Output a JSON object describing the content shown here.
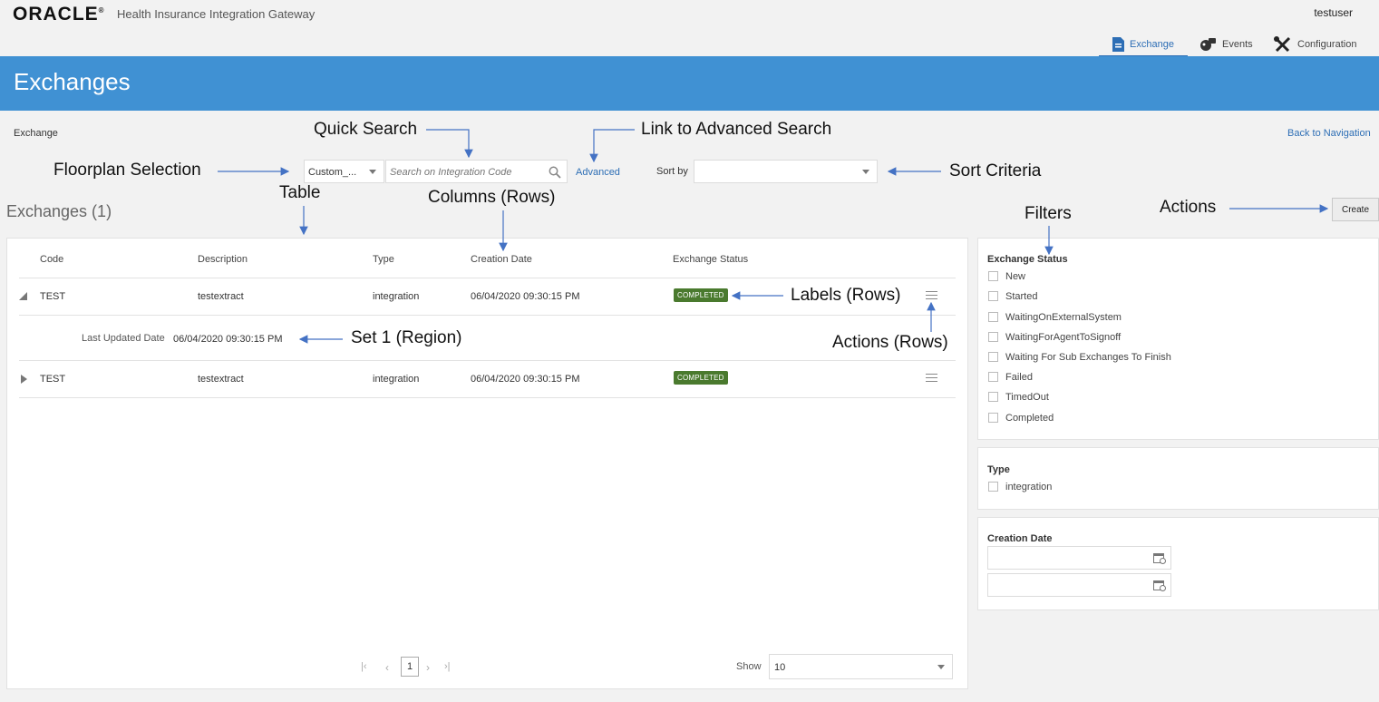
{
  "header": {
    "logo": "ORACLE",
    "app_name": "Health Insurance Integration Gateway",
    "user": "testuser",
    "tabs": [
      {
        "label": "Exchange",
        "icon": "document-icon",
        "active": true
      },
      {
        "label": "Events",
        "icon": "events-icon",
        "active": false
      },
      {
        "label": "Configuration",
        "icon": "tools-icon",
        "active": false
      }
    ]
  },
  "page": {
    "title": "Exchanges",
    "breadcrumb": "Exchange",
    "back_link": "Back to Navigation"
  },
  "toolbar": {
    "floorplan_value": "Custom_...",
    "search_placeholder": "Search on Integration Code",
    "advanced_link": "Advanced",
    "sort_label": "Sort by",
    "sort_value": "",
    "create_label": "Create"
  },
  "table": {
    "title": "Exchanges (1)",
    "columns": [
      "Code",
      "Description",
      "Type",
      "Creation Date",
      "Exchange Status"
    ],
    "rows": [
      {
        "code": "TEST",
        "description": "testextract",
        "type": "integration",
        "creation_date": "06/04/2020 09:30:15 PM",
        "status": "COMPLETED",
        "expanded": true
      },
      {
        "code": "TEST",
        "description": "testextract",
        "type": "integration",
        "creation_date": "06/04/2020 09:30:15 PM",
        "status": "COMPLETED",
        "expanded": false
      }
    ],
    "detail": {
      "label": "Last Updated Date",
      "value": "06/04/2020 09:30:15 PM"
    },
    "pagination": {
      "page": "1",
      "show_label": "Show",
      "page_size": "10"
    }
  },
  "filters": {
    "exchange_status": {
      "title": "Exchange Status",
      "options": [
        "New",
        "Started",
        "WaitingOnExternalSystem",
        "WaitingForAgentToSignoff",
        "Waiting For Sub Exchanges To Finish",
        "Failed",
        "TimedOut",
        "Completed"
      ]
    },
    "type": {
      "title": "Type",
      "options": [
        "integration"
      ]
    },
    "creation_date": {
      "title": "Creation Date"
    }
  },
  "annotations": {
    "quick_search": "Quick Search",
    "advanced_search": "Link to Advanced Search",
    "floorplan": "Floorplan Selection",
    "sort_criteria": "Sort Criteria",
    "table": "Table",
    "columns": "Columns  (Rows)",
    "actions": "Actions",
    "filters": "Filters",
    "labels": "Labels (Rows)",
    "set1": "Set 1 (Region)",
    "actions_rows": "Actions (Rows)"
  },
  "colors": {
    "banner": "#4091d3",
    "accent": "#2d6eb5",
    "badge": "#4a7a2e"
  }
}
